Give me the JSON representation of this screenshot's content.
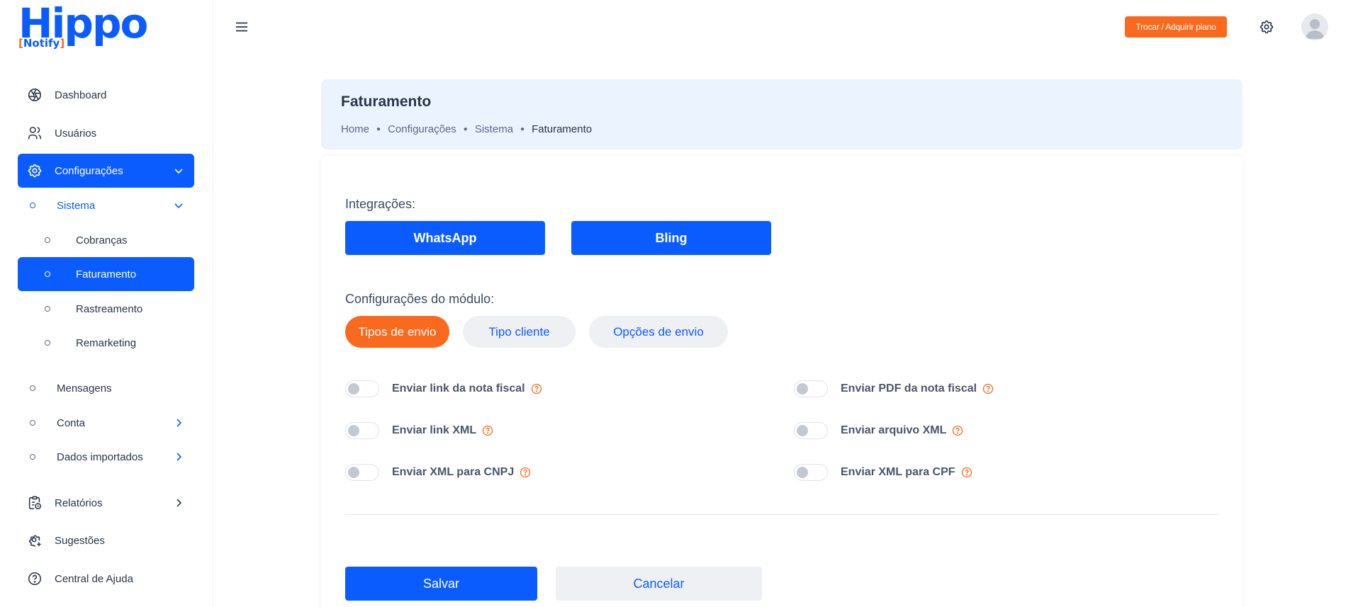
{
  "logo": {
    "main": "Hippo",
    "sub_open": "[",
    "sub_text": "Notify",
    "sub_close": "]"
  },
  "sidebar": {
    "items": [
      {
        "label": "Dashboard",
        "icon": "aperture-icon"
      },
      {
        "label": "Usuários",
        "icon": "users-icon"
      },
      {
        "label": "Configurações",
        "icon": "gear-icon",
        "active": true,
        "expanded": true
      },
      {
        "label": "Sistema",
        "expanded": true
      },
      {
        "label": "Cobranças"
      },
      {
        "label": "Faturamento",
        "active": true
      },
      {
        "label": "Rastreamento"
      },
      {
        "label": "Remarketing"
      },
      {
        "label": "Mensagens"
      },
      {
        "label": "Conta"
      },
      {
        "label": "Dados importados"
      },
      {
        "label": "Relatórios",
        "icon": "report-icon"
      },
      {
        "label": "Sugestões",
        "icon": "gear-plus-icon"
      },
      {
        "label": "Central de Ajuda",
        "icon": "help-circle-icon"
      }
    ]
  },
  "topbar": {
    "plan_button": "Trocar / Adquirir plano"
  },
  "breadcrumb": {
    "title": "Faturamento",
    "trail": [
      "Home",
      "Configurações",
      "Sistema",
      "Faturamento"
    ]
  },
  "integrations": {
    "label": "Integrações:",
    "buttons": [
      "WhatsApp",
      "Bling"
    ]
  },
  "module": {
    "label": "Configurações do módulo:",
    "tabs": [
      {
        "label": "Tipos de envio",
        "active": true
      },
      {
        "label": "Tipo cliente",
        "active": false
      },
      {
        "label": "Opções de envio",
        "active": false
      }
    ]
  },
  "toggles": [
    {
      "label": "Enviar link da nota fiscal",
      "on": false
    },
    {
      "label": "Enviar PDF da nota fiscal",
      "on": false
    },
    {
      "label": "Enviar link XML",
      "on": false
    },
    {
      "label": "Enviar arquivo XML",
      "on": false
    },
    {
      "label": "Enviar XML para CNPJ",
      "on": false
    },
    {
      "label": "Enviar XML para CPF",
      "on": false
    }
  ],
  "actions": {
    "save": "Salvar",
    "cancel": "Cancelar"
  },
  "colors": {
    "primary": "#0b5cff",
    "accent": "#fa6a1e",
    "breadcrumb_bg": "#ebf3fe"
  }
}
